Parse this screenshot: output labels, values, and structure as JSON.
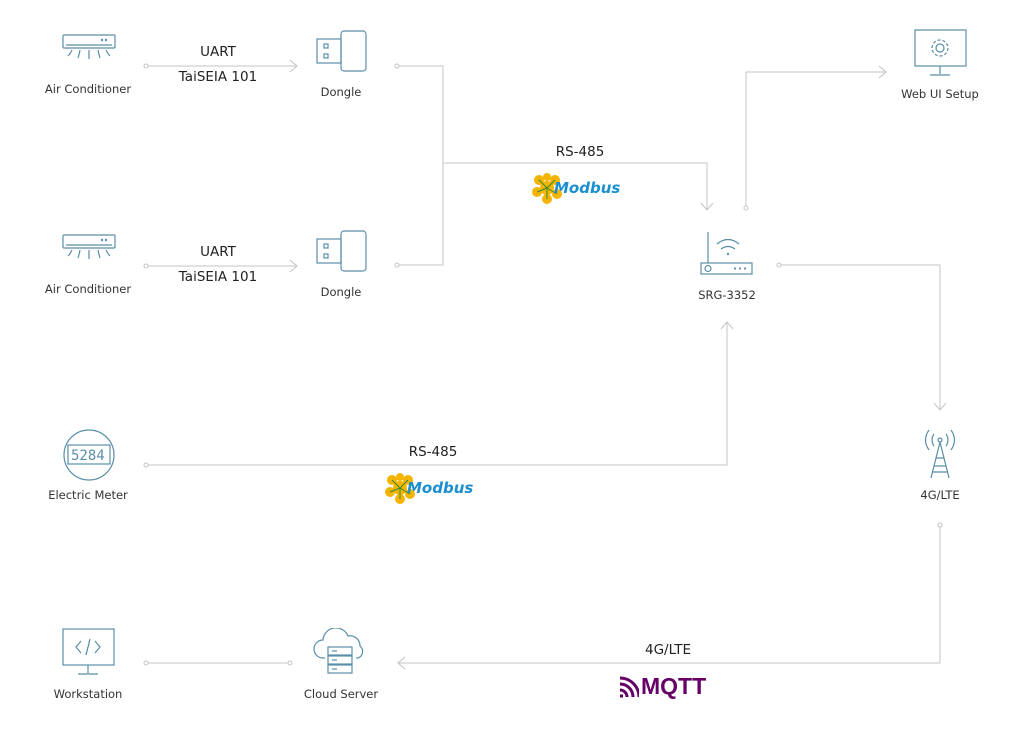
{
  "colors": {
    "line": "#c4c4c4",
    "icon": "#5a8ea8",
    "modbus_blue": "#1a8fd0",
    "modbus_orange": "#f5b400",
    "mqtt_purple": "#660066"
  },
  "nodes": {
    "ac1": {
      "label": "Air Conditioner",
      "icon": "air-conditioner-icon"
    },
    "ac2": {
      "label": "Air Conditioner",
      "icon": "air-conditioner-icon"
    },
    "dongle1": {
      "label": "Dongle",
      "icon": "usb-dongle-icon"
    },
    "dongle2": {
      "label": "Dongle",
      "icon": "usb-dongle-icon"
    },
    "gateway": {
      "label": "SRG-3352",
      "icon": "router-icon"
    },
    "webui": {
      "label": "Web UI Setup",
      "icon": "monitor-gear-icon"
    },
    "lte": {
      "label": "4G/LTE",
      "icon": "cell-tower-icon"
    },
    "meter": {
      "label": "Electric Meter",
      "icon": "electric-meter-icon",
      "display": "5284"
    },
    "cloud": {
      "label": "Cloud Server",
      "icon": "cloud-server-icon"
    },
    "workstation": {
      "label": "Workstation",
      "icon": "monitor-code-icon"
    }
  },
  "links": {
    "ac1_dongle": {
      "top": "UART",
      "bottom": "TaiSEIA 101"
    },
    "ac2_dongle": {
      "top": "UART",
      "bottom": "TaiSEIA 101"
    },
    "dongles_gateway": {
      "top": "RS-485",
      "logo": "Modbus"
    },
    "meter_gateway": {
      "top": "RS-485",
      "logo": "Modbus"
    },
    "lte_cloud": {
      "top": "4G/LTE",
      "logo": "MQTT"
    }
  }
}
